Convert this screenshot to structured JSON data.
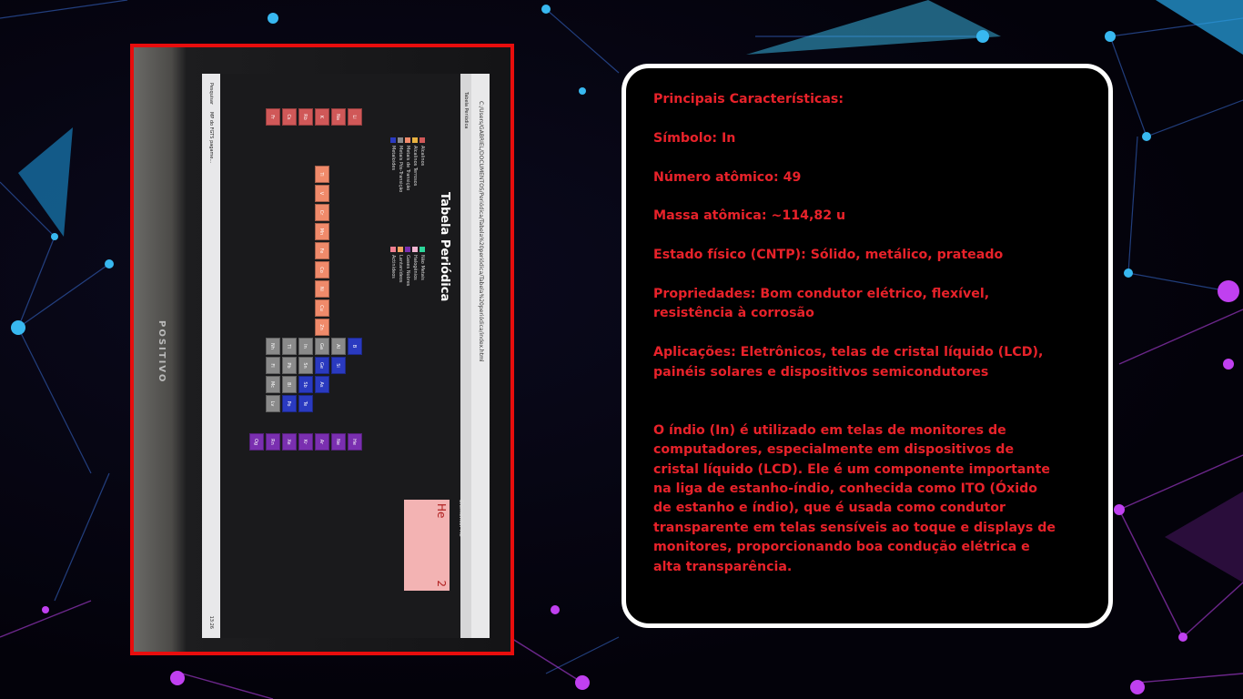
{
  "photo": {
    "browser_url": "C:/Users/GABRIEL/DOCUMENTOS/Periódica/Tabela%20periódica/Tabela%20periódica/index.html",
    "browser_tab": "Tabela Periódica",
    "app_title": "Tabela Periódica",
    "legend_left": [
      "Alcalinos",
      "Alcalinos Terrosos",
      "Metais de Transição",
      "Metais Pós-Transição",
      "Metaloides"
    ],
    "legend_right": [
      "Não Metais",
      "Halogênios",
      "Gases Nobres",
      "Lantanídeos",
      "Actinídeos"
    ],
    "legend_colors": [
      "#d05858",
      "#e8b240",
      "#f08a6a",
      "#8a8a8a",
      "#2a3ac0",
      "#2bd69a",
      "#f2b6d2",
      "#7a2fb0",
      "#f5a35e",
      "#f07e90"
    ],
    "element_label": "Elemento: He",
    "element_card_symbol": "He",
    "element_card_number": "2",
    "taskbar_text": "MP do FGTS pagame...",
    "taskbar_search": "Pesquisar",
    "taskbar_time": "13:26",
    "monitor_brand": "POSITIVO",
    "cells": [
      {
        "s": "Li",
        "c": "#d05858"
      },
      {
        "s": "Na",
        "c": "#d05858"
      },
      {
        "s": "K",
        "c": "#d05858"
      },
      {
        "s": "Rb",
        "c": "#d05858"
      },
      {
        "s": "Cs",
        "c": "#d05858"
      },
      {
        "s": "Fr",
        "c": "#d05858"
      },
      {
        "s": "Ti",
        "c": "#f08a6a"
      },
      {
        "s": "V",
        "c": "#f08a6a"
      },
      {
        "s": "Cr",
        "c": "#f08a6a"
      },
      {
        "s": "Mn",
        "c": "#f08a6a"
      },
      {
        "s": "Fe",
        "c": "#f08a6a"
      },
      {
        "s": "Co",
        "c": "#f08a6a"
      },
      {
        "s": "Ni",
        "c": "#f08a6a"
      },
      {
        "s": "Cu",
        "c": "#f08a6a"
      },
      {
        "s": "Zn",
        "c": "#f08a6a"
      },
      {
        "s": "B",
        "c": "#2a3ac0"
      },
      {
        "s": "Al",
        "c": "#8a8a8a"
      },
      {
        "s": "Ga",
        "c": "#8a8a8a"
      },
      {
        "s": "In",
        "c": "#8a8a8a"
      },
      {
        "s": "Tl",
        "c": "#8a8a8a"
      },
      {
        "s": "Nh",
        "c": "#8a8a8a"
      },
      {
        "s": "Si",
        "c": "#2a3ac0"
      },
      {
        "s": "Ge",
        "c": "#2a3ac0"
      },
      {
        "s": "Sn",
        "c": "#8a8a8a"
      },
      {
        "s": "Pb",
        "c": "#8a8a8a"
      },
      {
        "s": "Fl",
        "c": "#8a8a8a"
      },
      {
        "s": "As",
        "c": "#2a3ac0"
      },
      {
        "s": "Sb",
        "c": "#2a3ac0"
      },
      {
        "s": "Bi",
        "c": "#8a8a8a"
      },
      {
        "s": "Mc",
        "c": "#8a8a8a"
      },
      {
        "s": "Te",
        "c": "#2a3ac0"
      },
      {
        "s": "Po",
        "c": "#2a3ac0"
      },
      {
        "s": "Lv",
        "c": "#8a8a8a"
      },
      {
        "s": "He",
        "c": "#7a2fb0"
      },
      {
        "s": "Ne",
        "c": "#7a2fb0"
      },
      {
        "s": "Ar",
        "c": "#7a2fb0"
      },
      {
        "s": "Kr",
        "c": "#7a2fb0"
      },
      {
        "s": "Xe",
        "c": "#7a2fb0"
      },
      {
        "s": "Rn",
        "c": "#7a2fb0"
      },
      {
        "s": "Og",
        "c": "#7a2fb0"
      }
    ]
  },
  "info": {
    "heading": "Principais Características:",
    "symbol": "Símbolo: In",
    "atomic_number": "Número atômico: 49",
    "atomic_mass": "Massa atômica: ~114,82 u",
    "state": "Estado físico (CNTP): Sólido, metálico, prateado",
    "properties_1": "Propriedades: Bom condutor elétrico, flexível,",
    "properties_2": "resistência à corrosão",
    "applications_1": "Aplicações: Eletrônicos, telas de cristal líquido (LCD),",
    "applications_2": "painéis solares e dispositivos semicondutores",
    "para_1": "O índio (In) é utilizado em telas de monitores de",
    "para_2": "computadores, especialmente em dispositivos de",
    "para_3": "cristal líquido (LCD). Ele é um componente importante",
    "para_4": "na liga de estanho-índio, conhecida como ITO (Óxido",
    "para_5": "de estanho e índio), que é usada como condutor",
    "para_6": "transparente em telas sensíveis ao toque e displays de",
    "para_7": "monitores, proporcionando boa condução elétrica e",
    "para_8": "alta transparência."
  }
}
